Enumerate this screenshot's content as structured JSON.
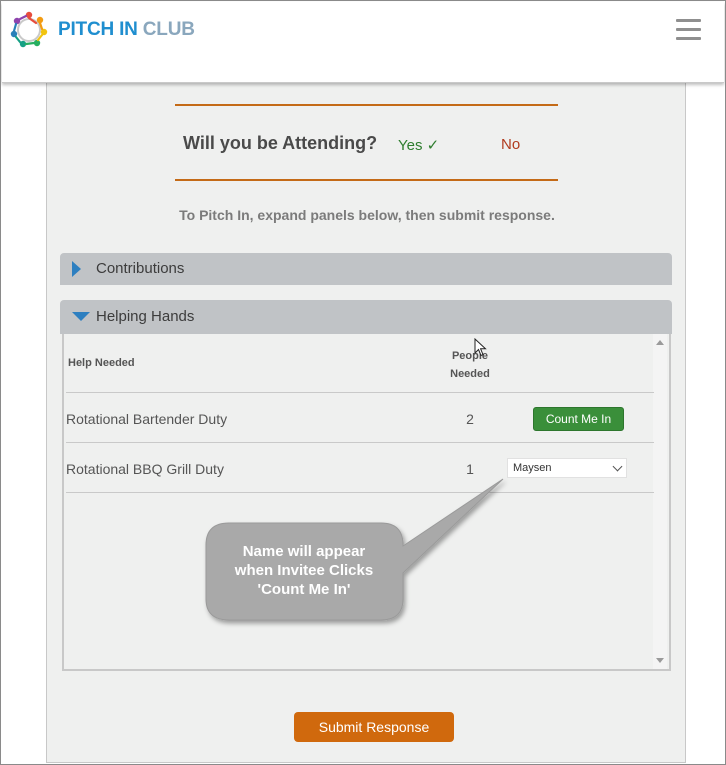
{
  "brand": {
    "name_part1": "PITCH IN",
    "name_part2": "CLUB",
    "logo_icon": "people-circle-logo-icon"
  },
  "header": {
    "menu_icon": "hamburger-menu-icon"
  },
  "attendance": {
    "question": "Will you be Attending?",
    "yes_label": "Yes",
    "yes_check": "✓",
    "no_label": "No",
    "yes_color": "#2e7d2e",
    "no_color": "#b13b1e"
  },
  "instruction": "To Pitch In, expand panels below, then submit response.",
  "panels": [
    {
      "title": "Contributions",
      "expanded": false
    },
    {
      "title": "Helping Hands",
      "expanded": true
    }
  ],
  "helping_table": {
    "columns": [
      "Help Needed",
      "People Needed"
    ],
    "column_people_line1": "People",
    "column_people_line2": "Needed",
    "rows": [
      {
        "task": "Rotational Bartender Duty",
        "people_needed": "2",
        "action": "Count Me In"
      },
      {
        "task": "Rotational BBQ Grill Duty",
        "people_needed": "1",
        "selected_name": "Maysen"
      }
    ]
  },
  "callout": {
    "line1": "Name will appear",
    "line2": "when Invitee Clicks",
    "line3": "'Count Me In'"
  },
  "submit_label": "Submit Response",
  "colors": {
    "brand_blue": "#1f8ecf",
    "brand_grey": "#8aa7bd",
    "accent_orange": "#c46a17",
    "submit_orange": "#d0690d",
    "count_me_in_green": "#3a8f3a",
    "panel_grey": "#c0c3c6",
    "panel_arrow_blue": "#2d7fc0"
  }
}
